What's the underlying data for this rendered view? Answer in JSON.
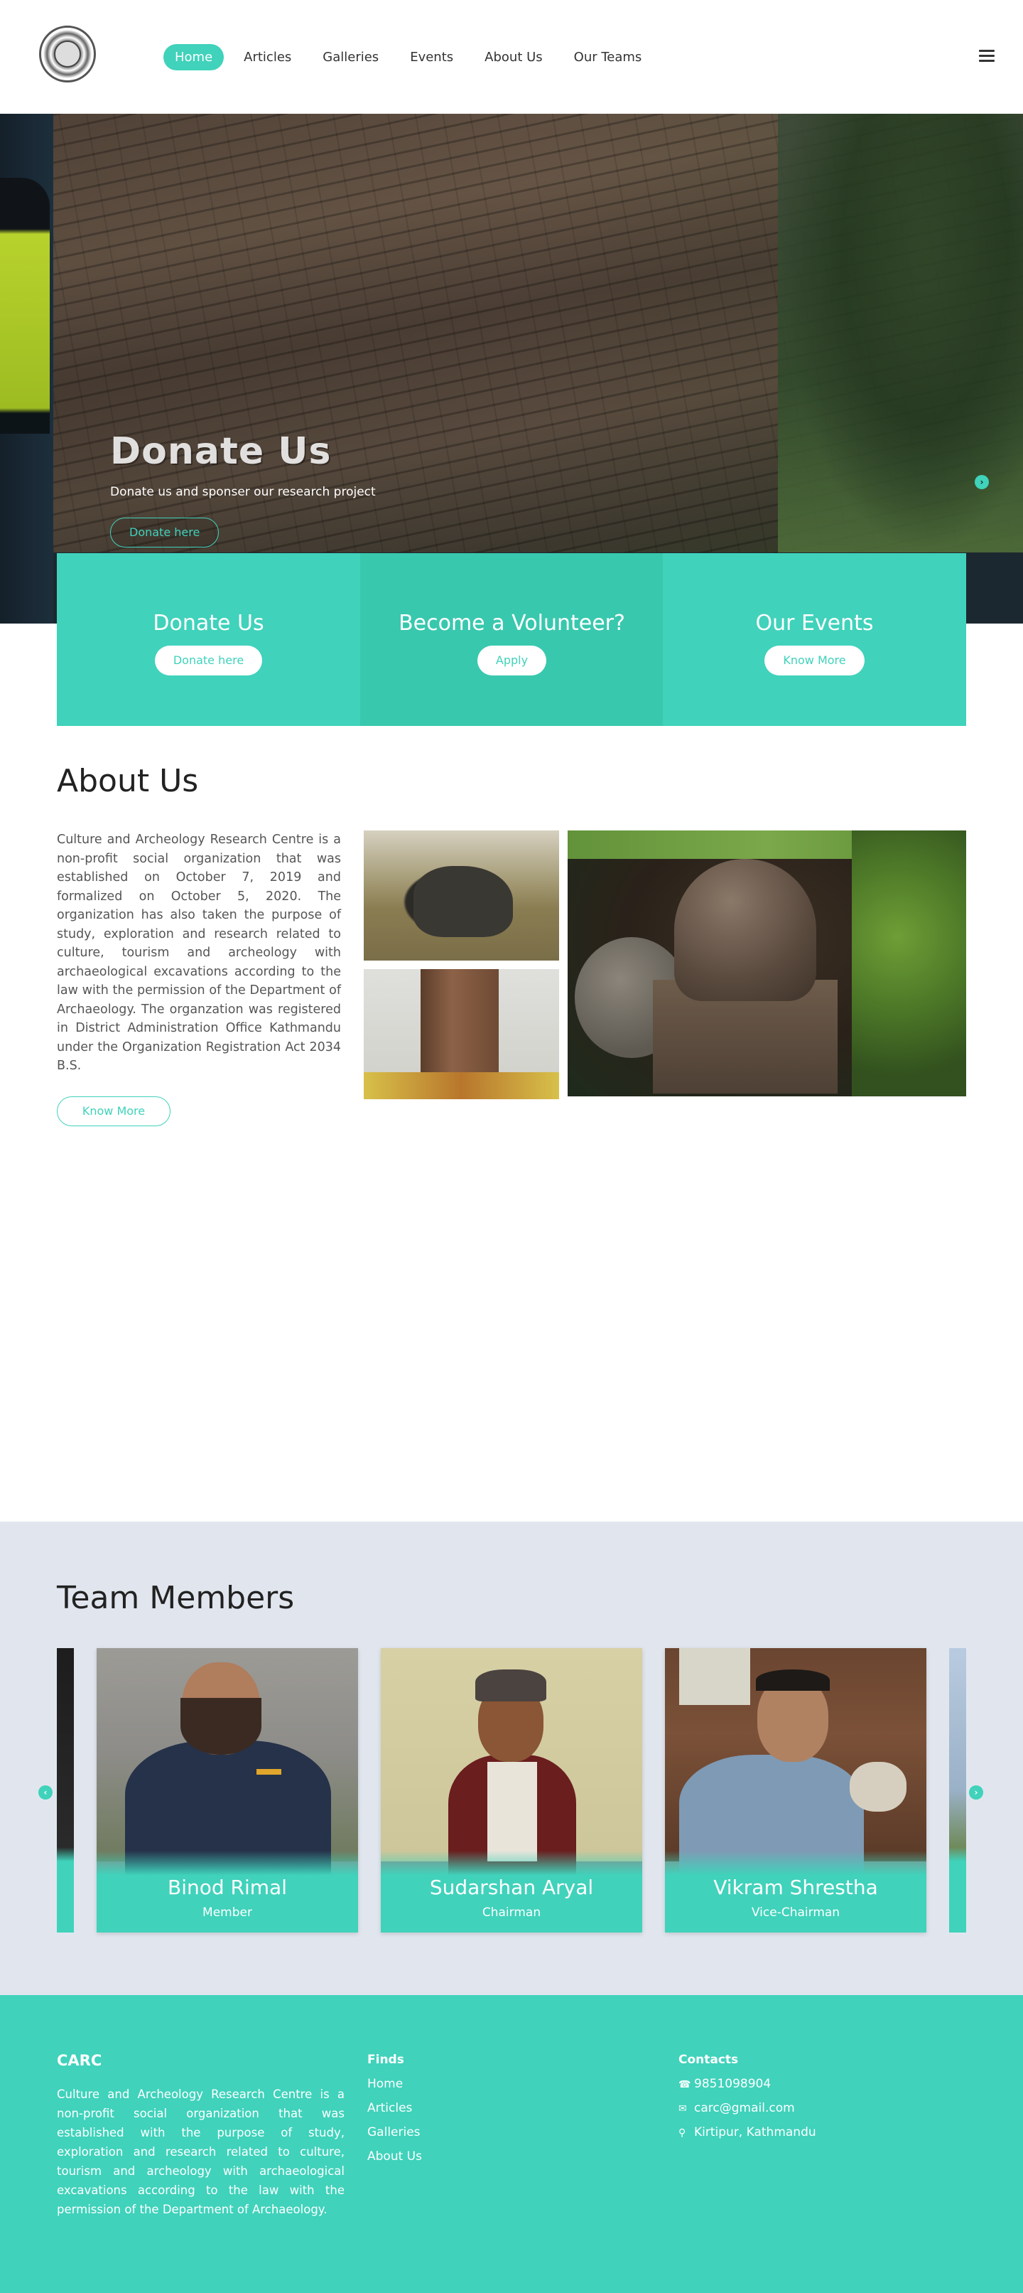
{
  "header": {
    "nav": [
      {
        "label": "Home",
        "active": true
      },
      {
        "label": "Articles"
      },
      {
        "label": "Galleries"
      },
      {
        "label": "Events"
      },
      {
        "label": "About Us"
      },
      {
        "label": "Our Teams"
      }
    ]
  },
  "hero": {
    "title": "Donate Us",
    "subtitle": "Donate us and sponser our research project",
    "button": "Donate here"
  },
  "cta": [
    {
      "title": "Donate Us",
      "button": "Donate here"
    },
    {
      "title": "Become a Volunteer?",
      "button": "Apply"
    },
    {
      "title": "Our Events",
      "button": "Know More"
    }
  ],
  "about": {
    "title": "About Us",
    "text": "Culture and Archeology Research Centre is a non-profit social organization that was established on October 7, 2019 and formalized on October 5, 2020. The organization has also taken the purpose of study, exploration and research related to culture, tourism and archeology with archaeological excavations according to the law with the permission of the Department of Archaeology. The organzation was registered in District Administration Office Kathmandu under the Organization Registration Act 2034 B.S.",
    "button": "Know More"
  },
  "team": {
    "title": "Team Members",
    "members": [
      {
        "name": "Binod Rimal",
        "role": "Member"
      },
      {
        "name": "Sudarshan Aryal",
        "role": "Chairman"
      },
      {
        "name": "Vikram Shrestha",
        "role": "Vice-Chairman"
      }
    ]
  },
  "footer": {
    "carc_title": "CARC",
    "carc_text": "Culture and Archeology Research Centre is a non-profit social organization that was established with the purpose of study, exploration and research related to culture, tourism and archeology with archaeological excavations according to the law with the permission of the Department of Archaeology.",
    "finds_title": "Finds",
    "finds": [
      "Home",
      "Articles",
      "Galleries",
      "About Us"
    ],
    "contacts_title": "Contacts",
    "phone": "9851098904",
    "email": "carc@gmail.com",
    "address": "Kirtipur, Kathmandu"
  },
  "colors": {
    "accent": "#40d2bb",
    "team_bg": "#e1e6ee"
  },
  "icons": [
    "logo",
    "hamburger-icon",
    "chevron-right-icon",
    "chevron-left-icon",
    "phone-icon",
    "envelope-icon",
    "map-marker-icon"
  ]
}
